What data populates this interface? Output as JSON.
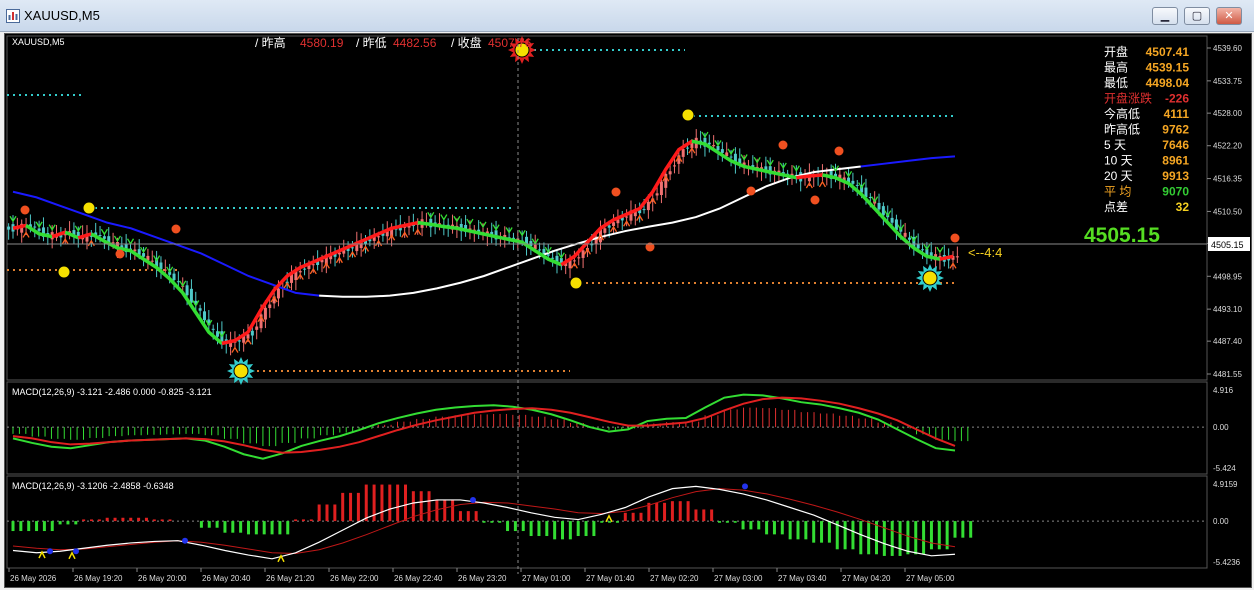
{
  "window": {
    "title": "XAUUSD,M5",
    "minimize_glyph": "▁",
    "maximize_glyph": "▢",
    "close_glyph": "✕"
  },
  "chart": {
    "symbol_label": "XAUUSD,M5",
    "header": {
      "prev_high_label": "/ 昨高",
      "prev_high_value": "4580.19",
      "prev_low_label": "/ 昨低",
      "prev_low_value": "4482.56",
      "close_label": "/ 收盘",
      "close_value": "4507.76"
    },
    "stats": [
      {
        "label": "开盘",
        "value": "4507.41",
        "label_color": "#ffffff",
        "value_color": "#f5a623"
      },
      {
        "label": "最高",
        "value": "4539.15",
        "label_color": "#ffffff",
        "value_color": "#f5a623"
      },
      {
        "label": "最低",
        "value": "4498.04",
        "label_color": "#ffffff",
        "value_color": "#f5a623"
      },
      {
        "label": "开盘涨跌",
        "value": "-226",
        "label_color": "#e03030",
        "value_color": "#e03030"
      },
      {
        "label": "今高低",
        "value": "4111",
        "label_color": "#ffffff",
        "value_color": "#f5a623"
      },
      {
        "label": "昨高低",
        "value": "9762",
        "label_color": "#ffffff",
        "value_color": "#f5a623"
      },
      {
        "label": "5  天",
        "value": "7646",
        "label_color": "#ffffff",
        "value_color": "#f5a623"
      },
      {
        "label": "10 天",
        "value": "8961",
        "label_color": "#ffffff",
        "value_color": "#f5a623"
      },
      {
        "label": "20 天",
        "value": "9913",
        "label_color": "#ffffff",
        "value_color": "#f5a623"
      },
      {
        "label": "平  均",
        "value": "9070",
        "label_color": "#f5a623",
        "value_color": "#33cc33"
      },
      {
        "label": "点差",
        "value": "32",
        "label_color": "#ffffff",
        "value_color": "#f5d020"
      }
    ],
    "big_price": "4505.15",
    "current_price_tag": "4505.15",
    "marker_text": "<--4:4",
    "colors": {
      "background": "#000000",
      "bull": "#f07070",
      "bear": "#4fc9c9",
      "trend_red": "#ff1a1a",
      "trend_green": "#33dd33",
      "ma_white": "#ffffff",
      "ma_blue": "#1a1aff",
      "dot_cyan": "#33cccc",
      "dot_orange": "#e08030",
      "grid": "#2a2a2a"
    }
  },
  "chart_data": [
    {
      "type": "line",
      "title": "XAUUSD,M5",
      "y_ticks": [
        "4539.60",
        "4533.75",
        "4528.00",
        "4522.20",
        "4516.35",
        "4510.50",
        "4504.80",
        "4498.95",
        "4493.10",
        "4487.40",
        "4481.55"
      ],
      "x_ticks": [
        "26 May 2026",
        "26 May 19:20",
        "26 May 20:00",
        "26 May 20:40",
        "26 May 21:20",
        "26 May 22:00",
        "26 May 22:40",
        "26 May 23:20",
        "27 May 01:00",
        "27 May 01:40",
        "27 May 02:20",
        "27 May 03:00",
        "27 May 03:40",
        "27 May 04:20",
        "27 May 05:00"
      ],
      "ylim": [
        4481.55,
        4539.6
      ],
      "series": [
        {
          "values": [
            4507.5,
            4508.0,
            4506.5,
            4506.0,
            4506.8,
            4505.8,
            4506.5,
            4505.2,
            4504.0,
            4503.5,
            4502.0,
            4500.5,
            4498.5,
            4496.0,
            4492.5,
            4489.0,
            4487.0,
            4487.5,
            4489.0,
            4493.0,
            4496.5,
            4499.0,
            4500.5,
            4501.5,
            4502.5,
            4503.5,
            4504.5,
            4505.5,
            4506.5,
            4507.5,
            4508.0,
            4508.5,
            4508.2,
            4507.8,
            4507.5,
            4507.0,
            4506.5,
            4506.0,
            4505.5,
            4505.0,
            4503.5,
            4502.0,
            4501.0,
            4502.5,
            4505.0,
            4507.5,
            4509.0,
            4510.0,
            4511.0,
            4514.0,
            4518.0,
            4521.5,
            4523.0,
            4522.5,
            4521.0,
            4519.5,
            4518.5,
            4518.0,
            4517.5,
            4517.0,
            4516.5,
            4516.8,
            4517.0,
            4516.5,
            4515.5,
            4513.5,
            4511.0,
            4508.5,
            4506.0,
            4504.0,
            4502.5,
            4502.0,
            4502.5
          ]
        },
        {
          "values": [
            4514.0,
            4513.0,
            4511.5,
            4510.0,
            4508.5,
            4507.5,
            4506.0,
            4504.5,
            4503.0,
            4501.0,
            4499.0,
            4497.5,
            4496.0,
            4495.5,
            4495.3,
            4495.3,
            4495.5,
            4496.0,
            4496.8,
            4497.8,
            4499.0,
            4500.5,
            4502.0,
            4503.5,
            4504.8,
            4506.0,
            4507.0,
            4507.8,
            4508.5,
            4509.5,
            4511.0,
            4513.0,
            4515.0,
            4516.5,
            4517.5,
            4518.0,
            4518.5,
            4519.0,
            4519.5,
            4520.0,
            4520.3
          ]
        }
      ]
    },
    {
      "type": "line",
      "title": "MACD(12,26,9) -3.121 -2.486 0.000 -0.825 -3.121",
      "y_ticks": [
        "4.916",
        "0.00",
        "-5.424"
      ],
      "ylim": [
        -5.424,
        4.916
      ],
      "series": [
        {
          "values": [
            -1.5,
            -2.1,
            -2.6,
            -2.8,
            -2.4,
            -2.0,
            -1.8,
            -1.7,
            -1.6,
            -1.5,
            -1.8,
            -2.6,
            -3.6,
            -4.2,
            -3.5,
            -2.5,
            -1.8,
            -1.2,
            -0.4,
            0.5,
            1.2,
            1.8,
            2.3,
            2.6,
            2.8,
            2.9,
            2.7,
            2.3,
            1.7,
            0.9,
            0.0,
            -0.6,
            -0.3,
            0.8,
            1.1,
            1.2,
            2.6,
            3.9,
            4.3,
            4.2,
            3.8,
            3.3,
            3.0,
            2.5,
            1.9,
            1.0,
            -0.3,
            -1.6,
            -2.8,
            -3.1
          ]
        },
        {
          "values": [
            -1.2,
            -1.5,
            -2.0,
            -2.3,
            -2.2,
            -2.0,
            -1.8,
            -1.7,
            -1.6,
            -1.5,
            -1.6,
            -1.9,
            -2.4,
            -3.0,
            -3.4,
            -3.3,
            -3.0,
            -2.6,
            -2.0,
            -1.2,
            -0.4,
            0.3,
            0.9,
            1.4,
            1.9,
            2.2,
            2.4,
            2.5,
            2.3,
            1.9,
            1.3,
            0.7,
            0.2,
            0.2,
            0.4,
            0.6,
            1.2,
            2.2,
            3.1,
            3.7,
            3.9,
            3.8,
            3.5,
            3.1,
            2.5,
            1.8,
            0.9,
            -0.3,
            -1.5,
            -2.5
          ]
        }
      ]
    },
    {
      "type": "line",
      "title": "MACD(12,26,9) -3.1206 -2.4858 -0.6348",
      "y_ticks": [
        "4.9159",
        "0.00",
        "-5.4236"
      ],
      "ylim": [
        -5.4236,
        4.9159
      ],
      "series": [
        {
          "values": [
            -3.9,
            -4.2,
            -4.0,
            -3.6,
            -3.2,
            -2.9,
            -2.7,
            -2.6,
            -3.2,
            -3.9,
            -4.5,
            -5.0,
            -4.2,
            -2.8,
            -1.2,
            0.4,
            1.6,
            2.4,
            2.8,
            2.8,
            2.4,
            1.8,
            1.1,
            0.5,
            0.2,
            0.9,
            1.8,
            3.2,
            4.3,
            4.6,
            4.2,
            3.6,
            2.8,
            1.8,
            0.8,
            -0.5,
            -1.8,
            -3.0,
            -4.0,
            -4.6,
            -4.4
          ]
        },
        {
          "values": [
            -3.3,
            -3.6,
            -3.8,
            -3.7,
            -3.4,
            -3.1,
            -2.8,
            -2.6,
            -2.8,
            -3.2,
            -3.7,
            -4.2,
            -4.3,
            -3.8,
            -2.9,
            -1.8,
            -0.6,
            0.6,
            1.5,
            2.2,
            2.5,
            2.4,
            2.0,
            1.6,
            1.1,
            1.0,
            1.3,
            2.1,
            3.1,
            3.9,
            4.3,
            4.1,
            3.6,
            2.9,
            2.1,
            1.2,
            0.2,
            -0.9,
            -2.0,
            -2.9,
            -3.4
          ]
        }
      ]
    }
  ]
}
